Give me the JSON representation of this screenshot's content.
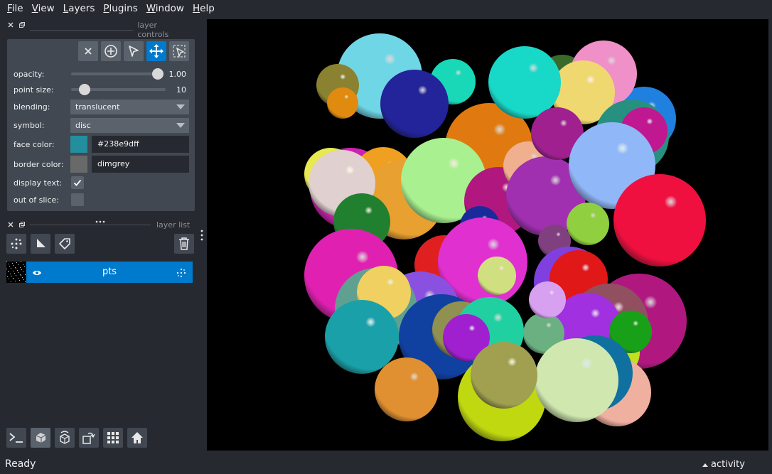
{
  "menu": [
    {
      "first": "F",
      "rest": "ile"
    },
    {
      "first": "V",
      "rest": "iew"
    },
    {
      "first": "L",
      "rest": "ayers"
    },
    {
      "first": "P",
      "rest": "lugins"
    },
    {
      "first": "W",
      "rest": "indow"
    },
    {
      "first": "H",
      "rest": "elp"
    }
  ],
  "layer_controls": {
    "title": "layer controls",
    "opacity_label": "opacity:",
    "opacity_value": "1.00",
    "opacity_fraction": 1.0,
    "point_size_label": "point size:",
    "point_size_value": "10",
    "blending_label": "blending:",
    "blending_value": "translucent",
    "symbol_label": "symbol:",
    "symbol_value": "disc",
    "face_color_label": "face color:",
    "face_color_value": "#238e9dff",
    "face_color_swatch": "#238e9d",
    "border_color_label": "border color:",
    "border_color_value": "dimgrey",
    "border_color_swatch": "#696969",
    "display_text_label": "display text:",
    "display_text_checked": true,
    "out_of_slice_label": "out of slice:",
    "out_of_slice_checked": false
  },
  "layer_list": {
    "title": "layer list",
    "layers": [
      {
        "name": "pts",
        "visible": true,
        "selected": true
      }
    ]
  },
  "status": {
    "text": "Ready",
    "activity": "activity"
  },
  "colors": {
    "accent": "#007acc",
    "panel": "#414851",
    "background": "#262930"
  }
}
